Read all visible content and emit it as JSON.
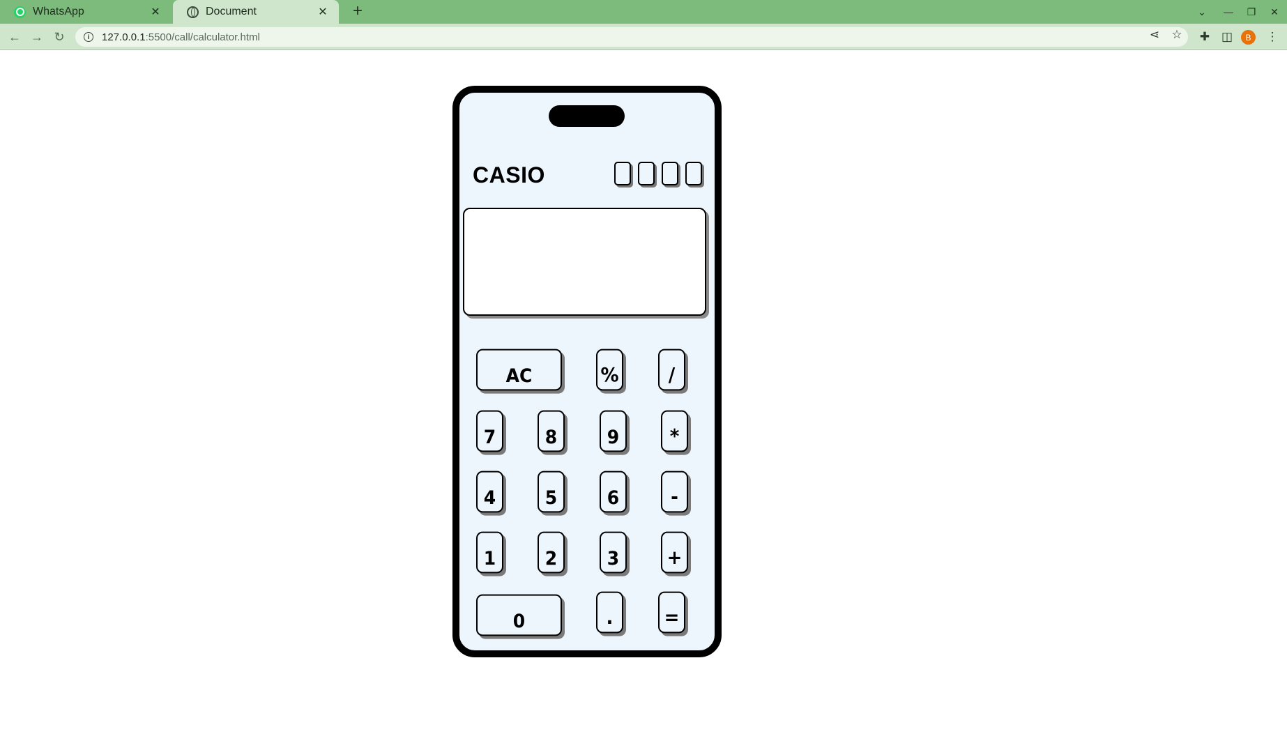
{
  "browser": {
    "tabs": [
      {
        "title": "WhatsApp",
        "icon": "whatsapp-icon",
        "active": false
      },
      {
        "title": "Document",
        "icon": "globe-icon",
        "active": true
      }
    ],
    "new_tab": "+",
    "url_host": "127.0.0.1",
    "url_path": ":5500/call/calculator.html",
    "profile_initial": "B",
    "colors": {
      "tabbar": "#7cbb7b",
      "toolbar": "#cfe5cc",
      "avatar": "#e8710a"
    }
  },
  "calculator": {
    "brand": "CASIO",
    "display_value": "",
    "keys": {
      "ac": "AC",
      "percent": "%",
      "divide": "/",
      "seven": "7",
      "eight": "8",
      "nine": "9",
      "multiply": "*",
      "four": "4",
      "five": "5",
      "six": "6",
      "minus": "-",
      "one": "1",
      "two": "2",
      "three": "3",
      "plus": "+",
      "zero": "0",
      "dot": ".",
      "equals": "="
    },
    "colors": {
      "body": "#eef6fd",
      "frame": "#000000",
      "shadow": "#7a7a7a"
    }
  }
}
